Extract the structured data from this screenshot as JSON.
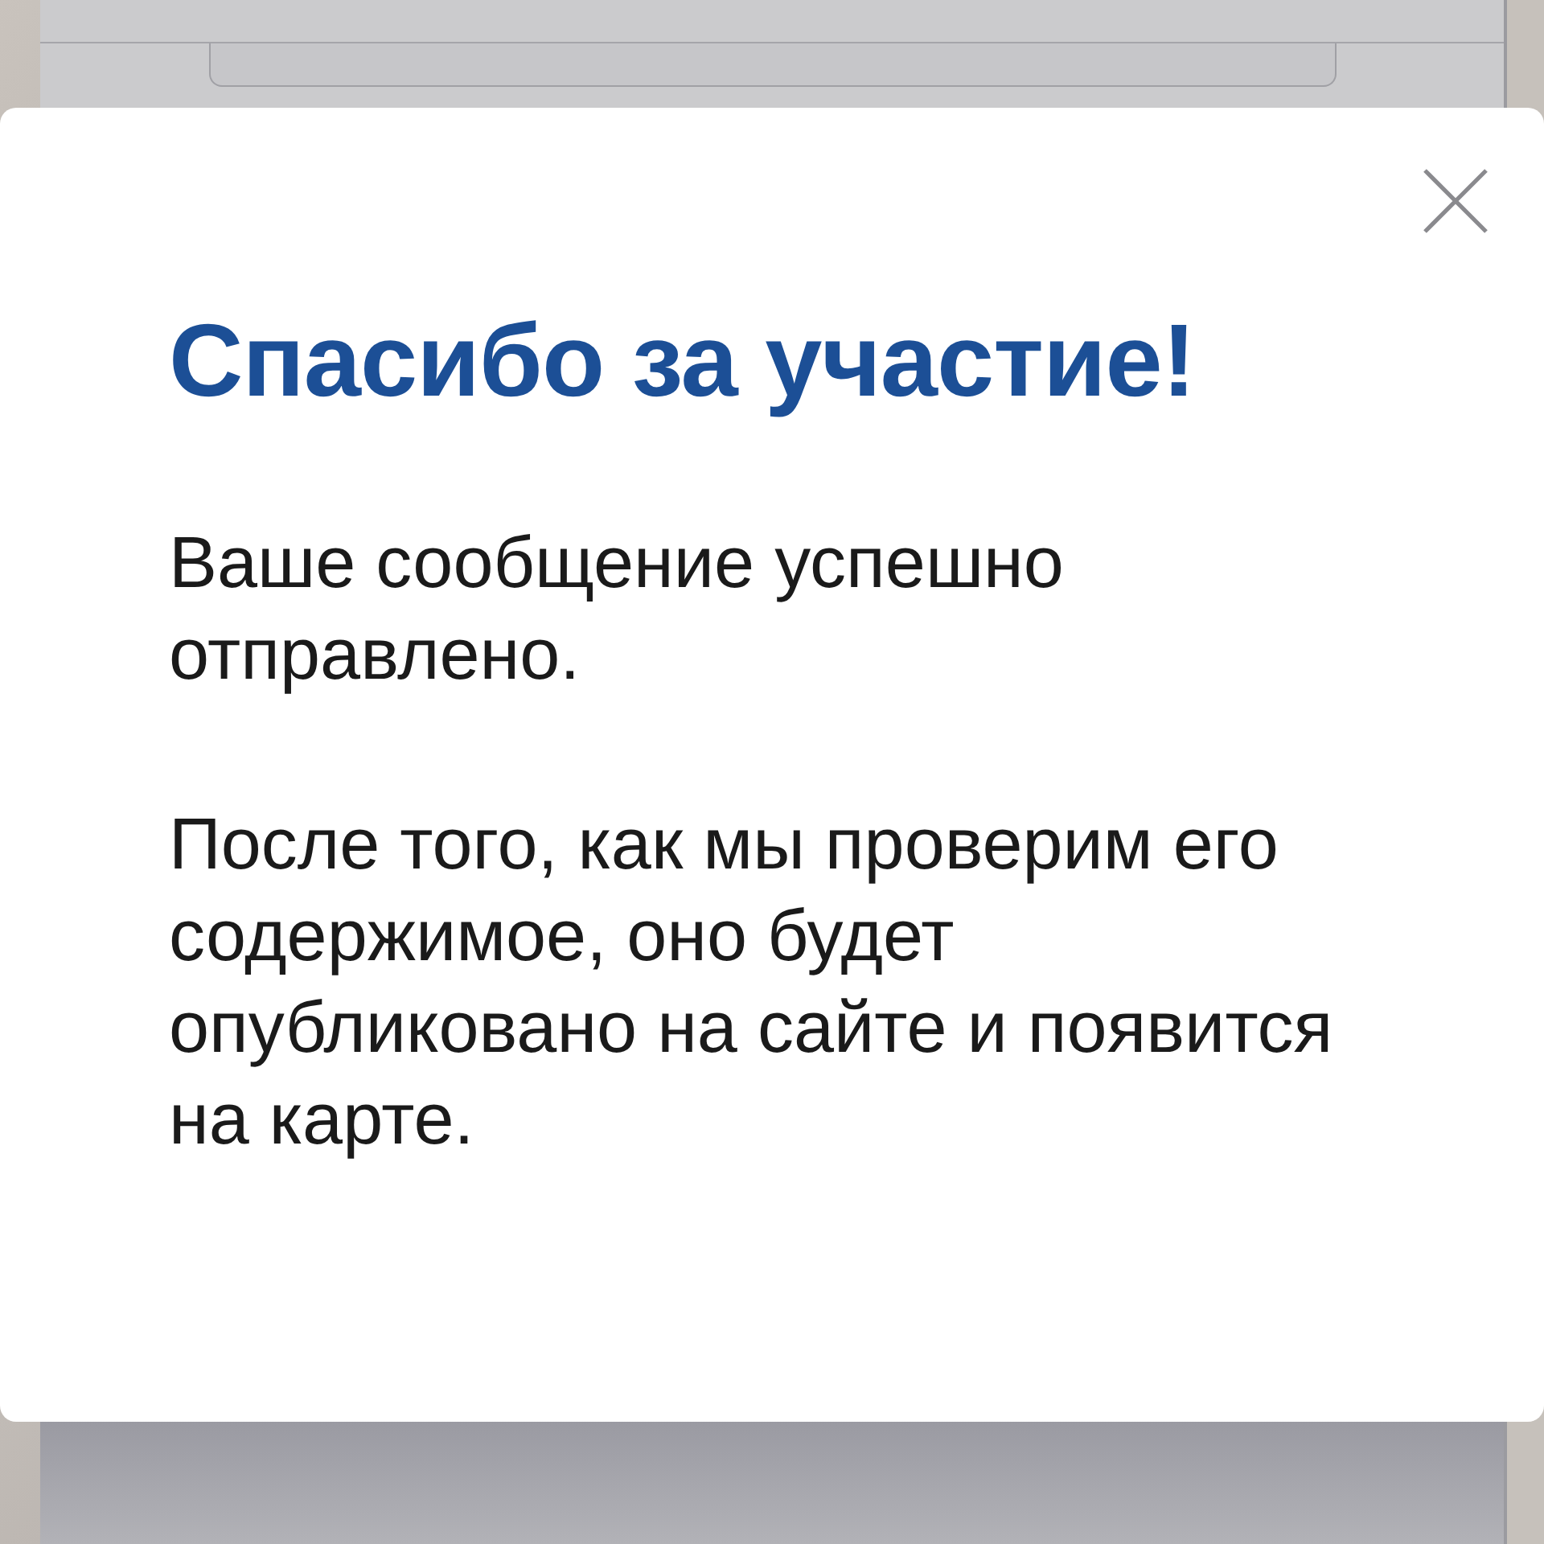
{
  "dialog": {
    "title": "Спасибо за участие!",
    "paragraphs": [
      "Ваше сообщение успешно отправлено.",
      "После того, как мы проверим его содержимое, оно будет опубликовано на сайте и появится на карте."
    ]
  }
}
